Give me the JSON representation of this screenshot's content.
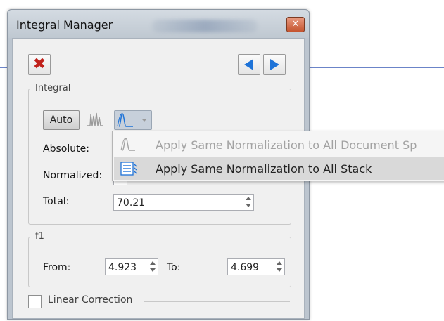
{
  "window": {
    "title": "Integral Manager"
  },
  "toolbar": {
    "delete_icon": "x-mark-icon",
    "prev_icon": "arrow-left-icon",
    "next_icon": "arrow-right-icon"
  },
  "integral": {
    "group_title": "Integral",
    "auto_label": "Auto",
    "absolute_label": "Absolute:",
    "normalized_label": "Normalized:",
    "total_label": "Total:",
    "total_value": "70.21"
  },
  "f1": {
    "group_title": "f1",
    "from_label": "From:",
    "from_value": "4.923",
    "to_label": "To:",
    "to_value": "4.699"
  },
  "linear_correction": {
    "label": "Linear Correction",
    "checked": false
  },
  "menu": {
    "items": [
      {
        "label": "Apply Same Normalization to All Document Sp",
        "enabled": false,
        "icon": "integral-curve-icon"
      },
      {
        "label": "Apply Same Normalization to All Stack",
        "enabled": true,
        "icon": "stack-list-icon"
      }
    ]
  },
  "colors": {
    "accent_blue": "#1e73d8",
    "delete_red": "#c0201a",
    "close_orange": "#c4532e"
  }
}
